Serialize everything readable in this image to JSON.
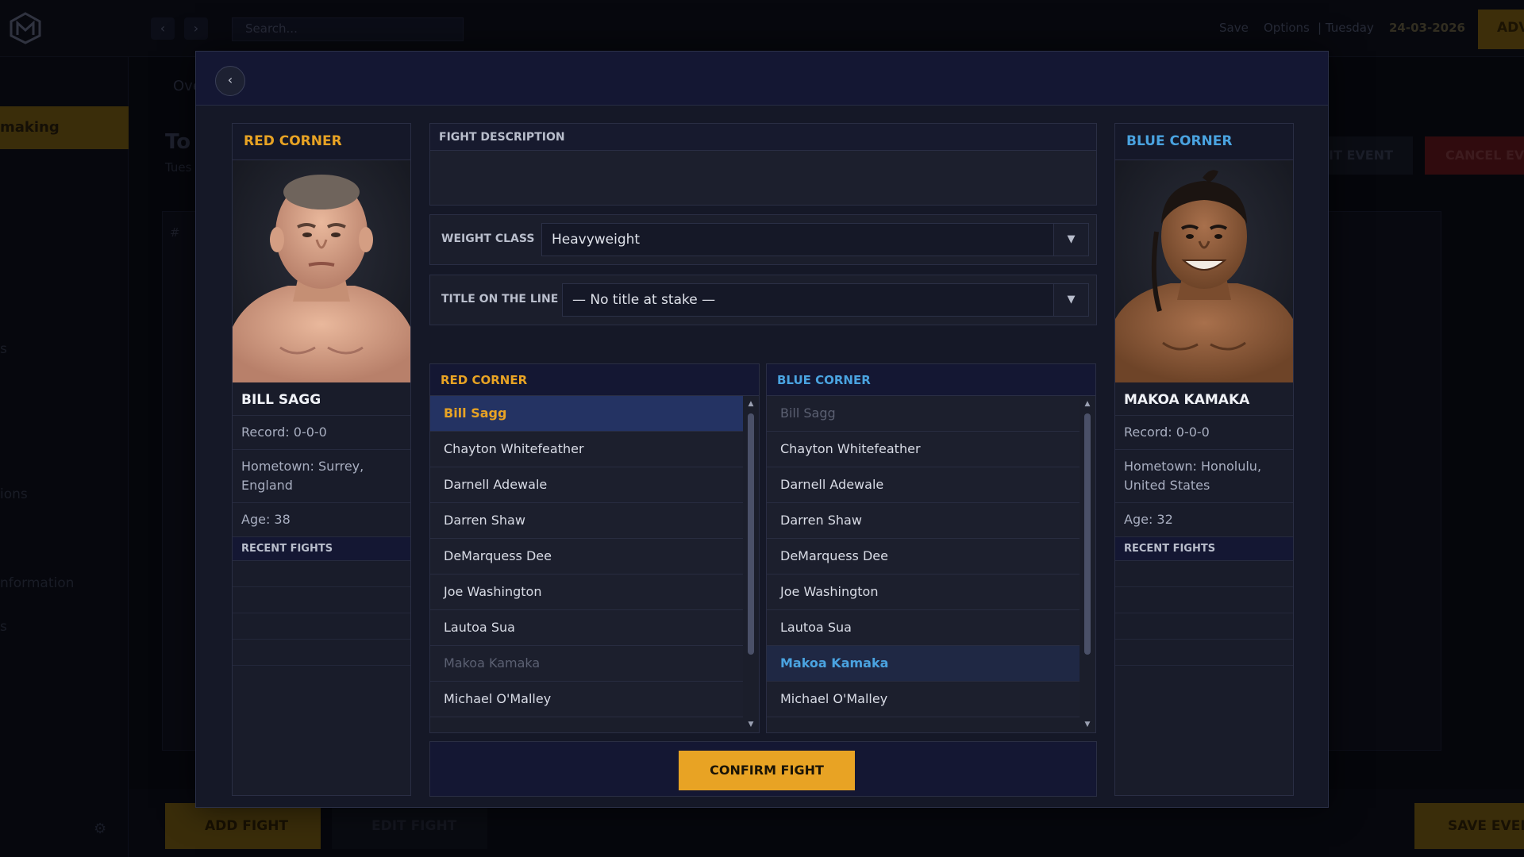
{
  "background": {
    "search_placeholder": "Search...",
    "top_links": [
      "Save",
      "Options"
    ],
    "weekday": "| Tuesday",
    "date": "24-03-2026",
    "adv_label": "ADV",
    "sidebar_active": "making",
    "sidebar_partial": [
      "s",
      "ions",
      "nformation",
      "s"
    ],
    "tab_partial": "Ove",
    "title_partial": "To",
    "subtitle_partial": "Tues",
    "edit_event": "IT EVENT",
    "cancel_event": "CANCEL EVE",
    "hash": "#",
    "add_fight": "ADD FIGHT",
    "edit_fight": "EDIT FIGHT",
    "save_event": "SAVE EVEN"
  },
  "modal": {
    "back_label": "‹",
    "fight_description_label": "FIGHT DESCRIPTION",
    "fight_description_value": "",
    "weight_class_label": "WEIGHT CLASS",
    "weight_class_value": "Heavyweight",
    "title_label": "TITLE ON THE LINE",
    "title_value": "— No title at stake —",
    "confirm_label": "CONFIRM FIGHT"
  },
  "red_corner": {
    "header": "RED CORNER",
    "name": "BILL SAGG",
    "record": "Record: 0-0-0",
    "hometown": "Hometown: Surrey, England",
    "age": "Age: 38",
    "recent_fights_label": "RECENT FIGHTS"
  },
  "blue_corner": {
    "header": "BLUE CORNER",
    "name": "MAKOA KAMAKA",
    "record": "Record: 0-0-0",
    "hometown": "Hometown: Honolulu, United States",
    "age": "Age: 32",
    "recent_fights_label": "RECENT FIGHTS"
  },
  "red_list": {
    "header": "RED CORNER",
    "items": [
      "Bill Sagg",
      "Chayton Whitefeather",
      "Darnell Adewale",
      "Darren Shaw",
      "DeMarquess Dee",
      "Joe Washington",
      "Lautoa Sua",
      "Makoa Kamaka",
      "Michael O'Malley"
    ],
    "selected": "Bill Sagg",
    "disabled": "Makoa Kamaka"
  },
  "blue_list": {
    "header": "BLUE CORNER",
    "items": [
      "Bill Sagg",
      "Chayton Whitefeather",
      "Darnell Adewale",
      "Darren Shaw",
      "DeMarquess Dee",
      "Joe Washington",
      "Lautoa Sua",
      "Makoa Kamaka",
      "Michael O'Malley"
    ],
    "selected": "Makoa Kamaka",
    "disabled": "Bill Sagg"
  },
  "colors": {
    "accent_gold": "#e8a324",
    "accent_blue": "#4aa3e0",
    "panel": "#151827"
  }
}
